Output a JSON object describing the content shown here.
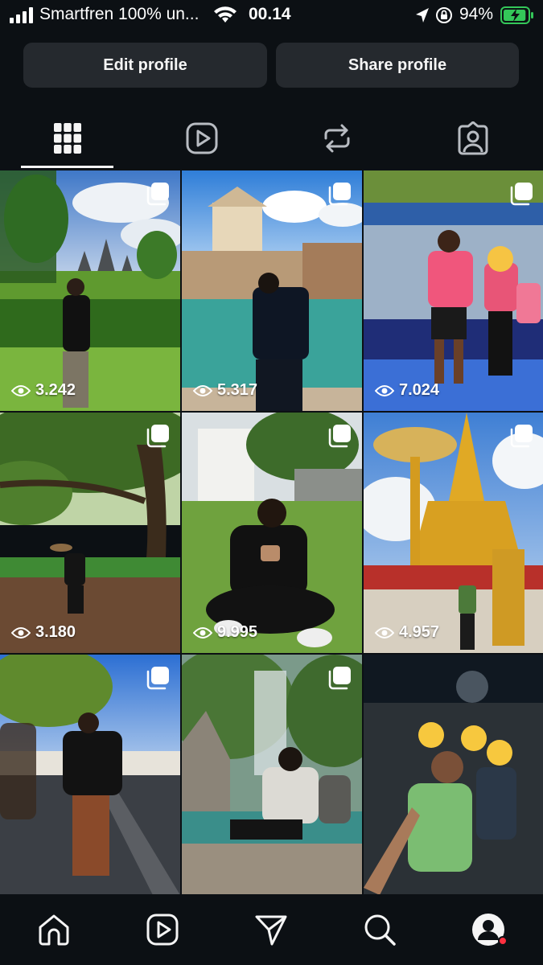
{
  "status_bar": {
    "carrier": "Smartfren 100% un...",
    "time": "00.14",
    "battery_percent": "94%",
    "battery_level": 0.94
  },
  "profile_actions": {
    "edit_label": "Edit profile",
    "share_label": "Share profile"
  },
  "tabs": [
    {
      "name": "posts-grid",
      "icon": "grid-icon",
      "active": true
    },
    {
      "name": "reels",
      "icon": "reels-icon",
      "active": false
    },
    {
      "name": "reposts",
      "icon": "repost-icon",
      "active": false
    },
    {
      "name": "tagged",
      "icon": "tagged-icon",
      "active": false
    }
  ],
  "posts": [
    {
      "views": "3.242",
      "multi": true
    },
    {
      "views": "5.317",
      "multi": true
    },
    {
      "views": "7.024",
      "multi": true
    },
    {
      "views": "3.180",
      "multi": true
    },
    {
      "views": "9.995",
      "multi": true
    },
    {
      "views": "4.957",
      "multi": true
    },
    {
      "views": "",
      "multi": true
    },
    {
      "views": "",
      "multi": true
    },
    {
      "views": "",
      "multi": false
    }
  ],
  "bottom_nav": [
    {
      "icon": "home-icon"
    },
    {
      "icon": "reels-icon"
    },
    {
      "icon": "send-icon"
    },
    {
      "icon": "search-icon"
    },
    {
      "icon": "profile-avatar-icon",
      "notification": true
    }
  ],
  "colors": {
    "background": "#0c1014",
    "button_bg": "#25292e",
    "text": "#f5f5f5",
    "notification": "#ff3040",
    "battery": "#34c759"
  }
}
